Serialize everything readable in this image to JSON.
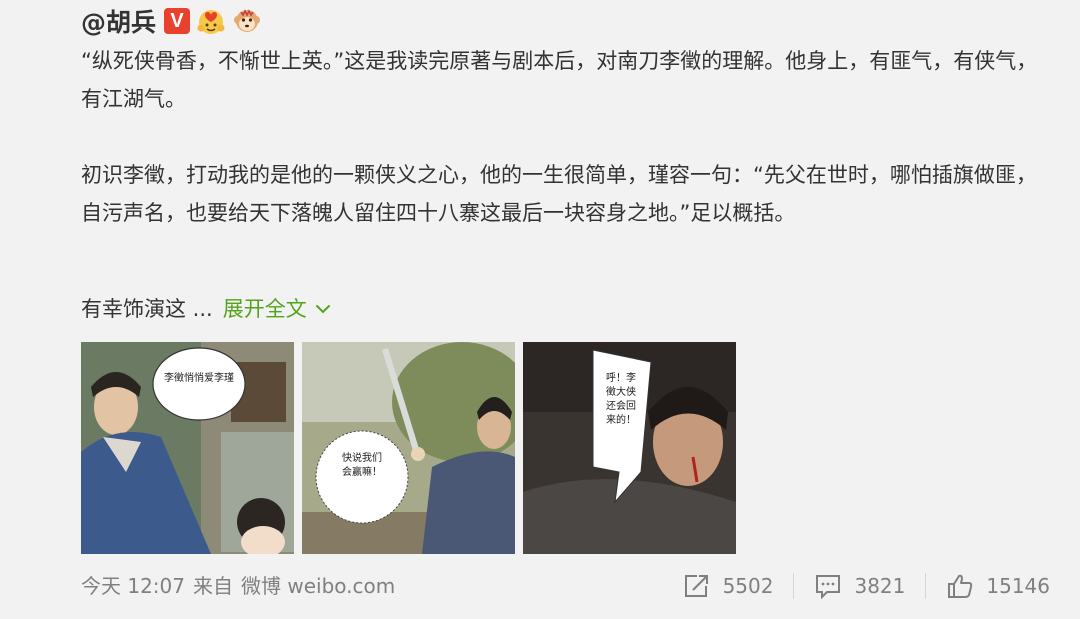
{
  "author": {
    "name": "@胡兵",
    "verified_letter": "V",
    "badges": [
      "verified-v-icon",
      "heart-hands-icon",
      "monkey-face-icon"
    ]
  },
  "post": {
    "paragraph_1": "“纵死侠骨香，不惭世上英。”这是我读完原著与剧本后，对南刀李徵的理解。他身上，有匪气，有侠气，有江湖气。",
    "paragraph_2": "初识李徵，打动我的是他的一颗侠义之心，他的一生很简单，瑾容一句：“先父在世时，哪怕插旗做匪，自污声名，也要给天下落魄人留住四十八寨这最后一块容身之地。”足以概括。",
    "truncated_text": "有幸饰演这 ...",
    "expand_label": "展开全文"
  },
  "images": [
    {
      "bubble_text": "李徵悄悄爱李瑾"
    },
    {
      "bubble_text": "快说我们会赢嘛！"
    },
    {
      "bubble_text": "呼！李徵大侠还会回来的！"
    }
  ],
  "footer": {
    "time": "今天 12:07",
    "source_prefix": "来自",
    "source": "微博 weibo.com",
    "repost_count": "5502",
    "comment_count": "3821",
    "like_count": "15146"
  },
  "colors": {
    "background": "#f2f2f2",
    "text": "#333333",
    "link": "#53a41a",
    "meta": "#808080",
    "verified": "#e8412e"
  }
}
